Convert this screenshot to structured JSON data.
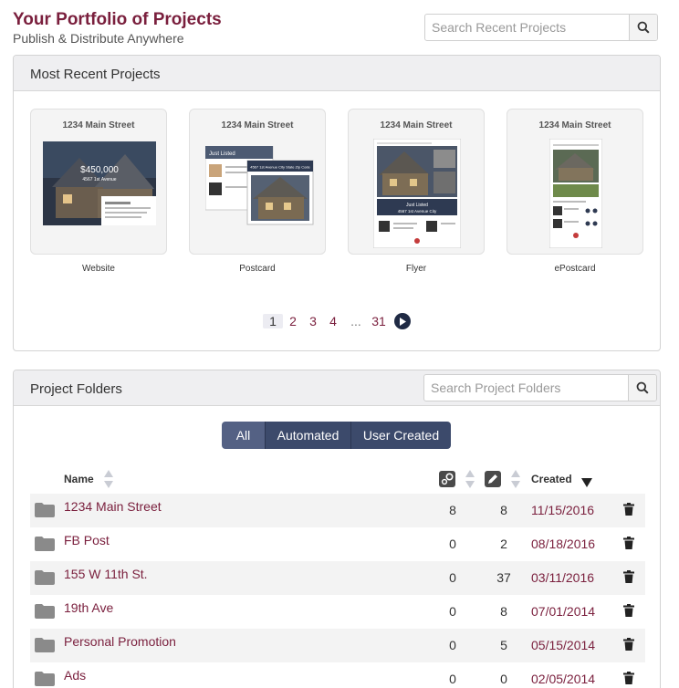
{
  "header": {
    "title": "Your Portfolio of Projects",
    "subtitle": "Publish & Distribute Anywhere",
    "search_placeholder": "Search Recent Projects"
  },
  "recent": {
    "title": "Most Recent Projects",
    "cards": [
      {
        "address": "1234 Main Street",
        "caption": "Website"
      },
      {
        "address": "1234 Main Street",
        "caption": "Postcard"
      },
      {
        "address": "1234 Main Street",
        "caption": "Flyer"
      },
      {
        "address": "1234 Main Street",
        "caption": "ePostcard"
      }
    ],
    "website_price": "$450,000",
    "website_street": "4567 1st Avenue",
    "postcard_label": "Just Listed",
    "postcard_address": "4567 1st Avenue City State Zip Code",
    "flyer_label": "Just Listed",
    "flyer_address": "4567 1st Avenue City",
    "pages": [
      "1",
      "2",
      "3",
      "4"
    ],
    "ellipsis": "...",
    "last_page": "31"
  },
  "folders": {
    "title": "Project Folders",
    "search_placeholder": "Search Project Folders",
    "filters": [
      "All",
      "Automated",
      "User Created"
    ],
    "active_filter": "All",
    "columns": {
      "name": "Name",
      "created": "Created"
    },
    "rows": [
      {
        "name": "1234 Main Street",
        "automated": "8",
        "user": "8",
        "created": "11/15/2016"
      },
      {
        "name": "FB Post",
        "automated": "0",
        "user": "2",
        "created": "08/18/2016"
      },
      {
        "name": "155 W 11th St.",
        "automated": "0",
        "user": "37",
        "created": "03/11/2016"
      },
      {
        "name": "19th Ave",
        "automated": "0",
        "user": "8",
        "created": "07/01/2014"
      },
      {
        "name": "Personal Promotion",
        "automated": "0",
        "user": "5",
        "created": "05/15/2014"
      },
      {
        "name": "Ads",
        "automated": "0",
        "user": "0",
        "created": "02/05/2014"
      }
    ]
  },
  "colors": {
    "brand": "#7a1f3d",
    "segment": "#3c4a6b",
    "panel_header": "#efeff1"
  }
}
